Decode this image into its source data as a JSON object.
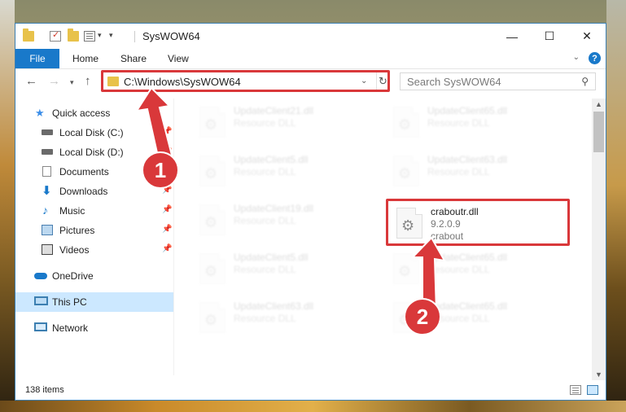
{
  "window": {
    "title": "SysWOW64",
    "controls": {
      "minimize": "—",
      "maximize": "☐",
      "close": "✕"
    }
  },
  "ribbon": {
    "tabs": [
      "File",
      "Home",
      "Share",
      "View"
    ],
    "help": "?"
  },
  "nav": {
    "address": "C:\\Windows\\SysWOW64",
    "search_placeholder": "Search SysWOW64"
  },
  "sidebar": {
    "items": [
      {
        "label": "Quick access",
        "icon": "star-icon",
        "pinned": false
      },
      {
        "label": "Local Disk (C:)",
        "icon": "drive-icon",
        "pinned": true
      },
      {
        "label": "Local Disk (D:)",
        "icon": "drive-icon",
        "pinned": true
      },
      {
        "label": "Documents",
        "icon": "documents-icon",
        "pinned": true
      },
      {
        "label": "Downloads",
        "icon": "download-icon",
        "pinned": true
      },
      {
        "label": "Music",
        "icon": "music-icon",
        "pinned": true
      },
      {
        "label": "Pictures",
        "icon": "pictures-icon",
        "pinned": true
      },
      {
        "label": "Videos",
        "icon": "videos-icon",
        "pinned": true
      },
      {
        "label": "OneDrive",
        "icon": "cloud-icon",
        "pinned": false
      },
      {
        "label": "This PC",
        "icon": "computer-icon",
        "pinned": false,
        "selected": true
      },
      {
        "label": "Network",
        "icon": "network-icon",
        "pinned": false
      }
    ]
  },
  "files": [
    {
      "name": "UpdateClient21.dll",
      "type": "Resource DLL"
    },
    {
      "name": "UpdateClient65.dll",
      "type": "Resource DLL"
    },
    {
      "name": "UpdateClient5.dll",
      "type": "Resource DLL"
    },
    {
      "name": "UpdateClient63.dll",
      "type": "Resource DLL"
    },
    {
      "name": "UpdateClient19.dll",
      "type": "Resource DLL"
    },
    {
      "name": "craboutr.dll",
      "version": "9.2.0.9",
      "company": "crabout"
    },
    {
      "name": "UpdateClient5.dll",
      "type": "Resource DLL"
    },
    {
      "name": "UpdateClient65.dll",
      "type": "Resource DLL"
    },
    {
      "name": "UpdateClient63.dll",
      "type": "Resource DLL"
    },
    {
      "name": "UpdateClient65.dll",
      "type": "Resource DLL"
    }
  ],
  "status": {
    "count": "138 items"
  },
  "annotations": {
    "step1": "1",
    "step2": "2"
  },
  "colors": {
    "accent": "#1979ca",
    "highlight": "#d9383a",
    "selected": "#cce8ff"
  }
}
